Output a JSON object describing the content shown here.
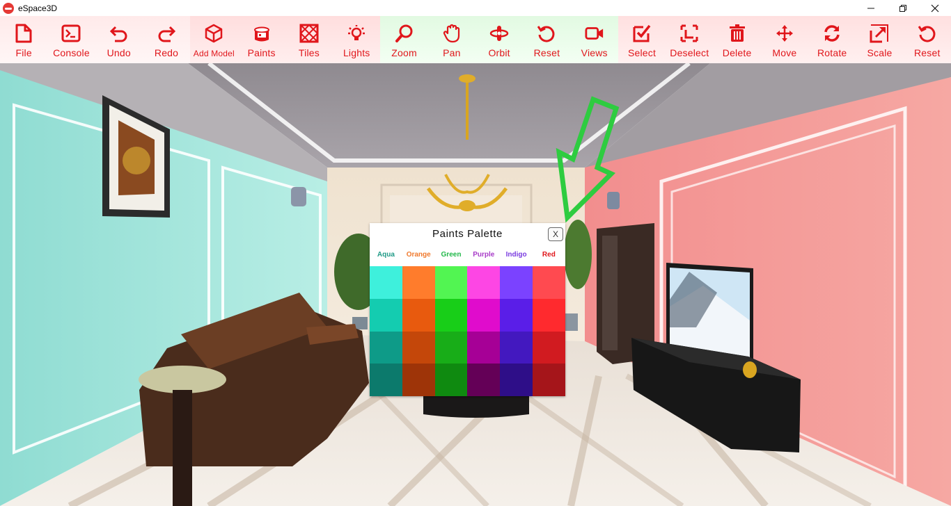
{
  "window": {
    "title": "eSpace3D"
  },
  "toolbar": {
    "groups": [
      {
        "tools": [
          {
            "label": "File",
            "icon": "file-icon"
          },
          {
            "label": "Console",
            "icon": "console-icon"
          },
          {
            "label": "Undo",
            "icon": "undo-icon"
          },
          {
            "label": "Redo",
            "icon": "redo-icon"
          }
        ]
      },
      {
        "tools": [
          {
            "label": "Add Model",
            "icon": "cube-icon"
          },
          {
            "label": "Paints",
            "icon": "paint-bucket-icon"
          },
          {
            "label": "Tiles",
            "icon": "tiles-icon"
          },
          {
            "label": "Lights",
            "icon": "bulb-icon"
          }
        ]
      },
      {
        "tools": [
          {
            "label": "Zoom",
            "icon": "zoom-icon"
          },
          {
            "label": "Pan",
            "icon": "hand-icon"
          },
          {
            "label": "Orbit",
            "icon": "orbit-icon"
          },
          {
            "label": "Reset",
            "icon": "reset-icon"
          },
          {
            "label": "Views",
            "icon": "camera-icon"
          }
        ]
      },
      {
        "tools": [
          {
            "label": "Select",
            "icon": "select-icon"
          },
          {
            "label": "Deselect",
            "icon": "deselect-icon"
          },
          {
            "label": "Delete",
            "icon": "trash-icon"
          },
          {
            "label": "Move",
            "icon": "move-icon"
          },
          {
            "label": "Rotate",
            "icon": "rotate-icon"
          },
          {
            "label": "Scale",
            "icon": "scale-icon"
          },
          {
            "label": "Reset",
            "icon": "reset-icon"
          }
        ]
      }
    ]
  },
  "palette": {
    "title": "Paints Palette",
    "close_label": "X",
    "columns": [
      {
        "name": "Aqua",
        "color": "#1f9a86",
        "shades": [
          "#3ef0dc",
          "#14ccb0",
          "#0e9b88",
          "#0c7a6c"
        ]
      },
      {
        "name": "Orange",
        "color": "#f07a2e",
        "shades": [
          "#ff7c2c",
          "#e85a0e",
          "#c4470a",
          "#9e3408"
        ]
      },
      {
        "name": "Green",
        "color": "#22b84a",
        "shades": [
          "#52f552",
          "#18ce18",
          "#18ad18",
          "#0f8a10"
        ]
      },
      {
        "name": "Purple",
        "color": "#a83cc8",
        "shades": [
          "#fd46e4",
          "#e00ccc",
          "#a60096",
          "#640057"
        ]
      },
      {
        "name": "Indigo",
        "color": "#7a3ce0",
        "shades": [
          "#7b42ff",
          "#5a1ee8",
          "#4318bf",
          "#2e0e88"
        ]
      },
      {
        "name": "Red",
        "color": "#e0161b",
        "shades": [
          "#ff4a50",
          "#ff2a2e",
          "#d11b20",
          "#a5151a"
        ]
      }
    ]
  }
}
